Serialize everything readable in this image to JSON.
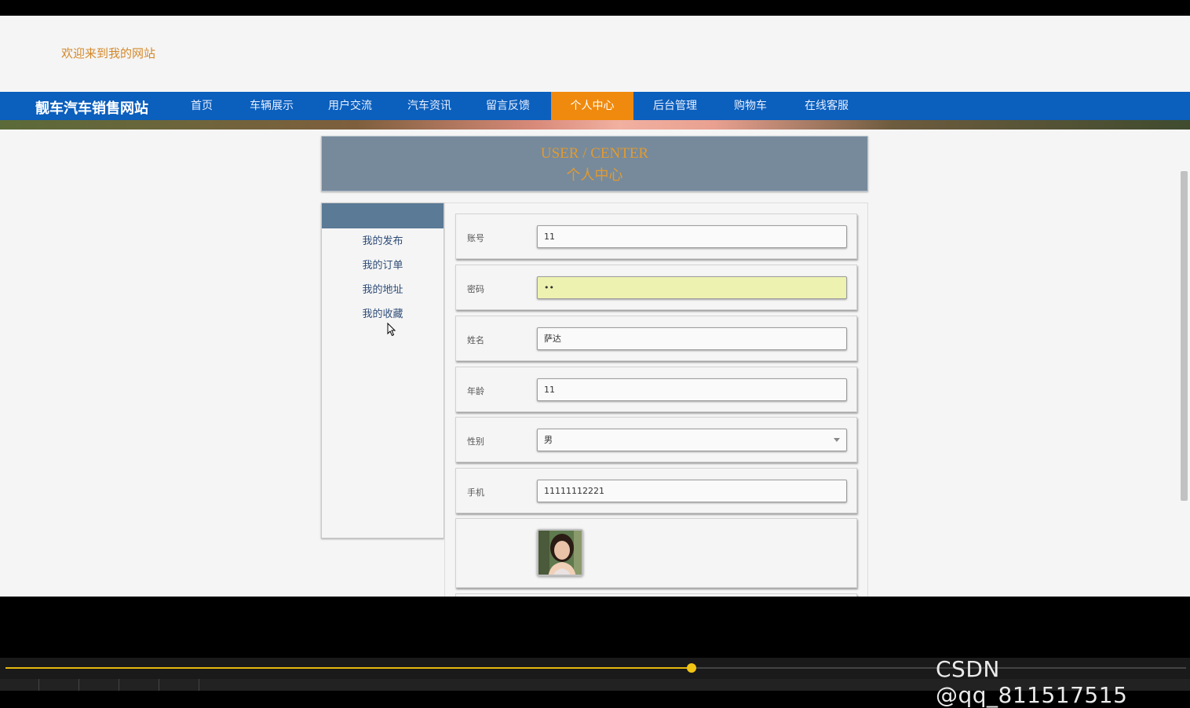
{
  "site": {
    "welcome": "欢迎来到我的网站",
    "brand": "靓车汽车销售网站"
  },
  "nav": {
    "items": [
      {
        "label": "首页",
        "active": false
      },
      {
        "label": "车辆展示",
        "active": false
      },
      {
        "label": "用户交流",
        "active": false
      },
      {
        "label": "汽车资讯",
        "active": false
      },
      {
        "label": "留言反馈",
        "active": false
      },
      {
        "label": "个人中心",
        "active": true
      },
      {
        "label": "后台管理",
        "active": false
      },
      {
        "label": "购物车",
        "active": false
      },
      {
        "label": "在线客服",
        "active": false
      }
    ]
  },
  "header": {
    "title_en": "USER / CENTER",
    "title_cn": "个人中心"
  },
  "sidebar": {
    "items": [
      "我的发布",
      "我的订单",
      "我的地址",
      "我的收藏"
    ]
  },
  "form": {
    "account_label": "账号",
    "account_value": "11",
    "password_label": "密码",
    "password_value": "••",
    "name_label": "姓名",
    "name_value": "萨达",
    "age_label": "年龄",
    "age_value": "11",
    "gender_label": "性别",
    "gender_value": "男",
    "phone_label": "手机",
    "phone_value": "11111112221"
  },
  "player": {
    "watermark": "CSDN @qq_811517515",
    "progress_fraction": 0.58
  },
  "colors": {
    "nav_bg": "#0b5fbd",
    "nav_active": "#f08a0e",
    "accent_orange": "#d4892a",
    "header_panel": "#768a9c",
    "progress": "#e5b90e"
  }
}
